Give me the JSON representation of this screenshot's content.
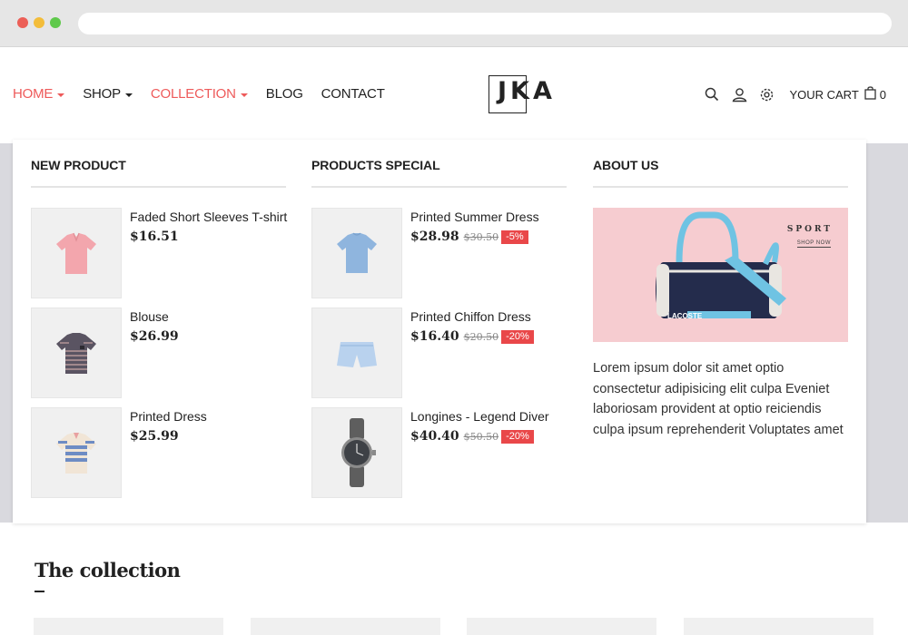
{
  "nav": {
    "items": [
      {
        "label": "HOME",
        "active": true,
        "dropdown": true
      },
      {
        "label": "SHOP",
        "active": false,
        "dropdown": true
      },
      {
        "label": "COLLECTION",
        "active": true,
        "dropdown": true
      },
      {
        "label": "BLOG",
        "active": false,
        "dropdown": false
      },
      {
        "label": "CONTACT",
        "active": false,
        "dropdown": false
      }
    ]
  },
  "logo": {
    "text": "JKA"
  },
  "header_tools": {
    "icons": [
      "search-icon",
      "user-icon",
      "gear-icon"
    ],
    "cart_label": "YOUR CART",
    "cart_count": "0"
  },
  "mega_menu": {
    "new_product": {
      "title": "NEW PRODUCT",
      "items": [
        {
          "name": "Faded Short Sleeves T-shirt",
          "price": "$16.51"
        },
        {
          "name": "Blouse",
          "price": "$26.99"
        },
        {
          "name": "Printed Dress",
          "price": "$25.99"
        }
      ]
    },
    "products_special": {
      "title": "PRODUCTS SPECIAL",
      "items": [
        {
          "name": "Printed Summer Dress",
          "price": "$28.98",
          "old_price": "$30.50",
          "discount": "-5%"
        },
        {
          "name": "Printed Chiffon Dress",
          "price": "$16.40",
          "old_price": "$20.50",
          "discount": "-20%"
        },
        {
          "name": "Longines - Legend Diver",
          "price": "$40.40",
          "old_price": "$50.50",
          "discount": "-20%"
        }
      ]
    },
    "about_us": {
      "title": "ABOUT US",
      "banner_heading": "SPORT",
      "banner_link": "SHOP NOW",
      "banner_brand": "LACOSTE",
      "text": "Lorem ipsum dolor sit amet optio consectetur adipisicing elit culpa Eveniet laboriosam provident at optio reiciendis culpa ipsum reprehenderit Voluptates amet"
    }
  },
  "collection": {
    "title": "The collection"
  },
  "colors": {
    "accent": "#ee5a5a",
    "discount": "#e94749",
    "banner_bg": "#f6ccd0"
  }
}
